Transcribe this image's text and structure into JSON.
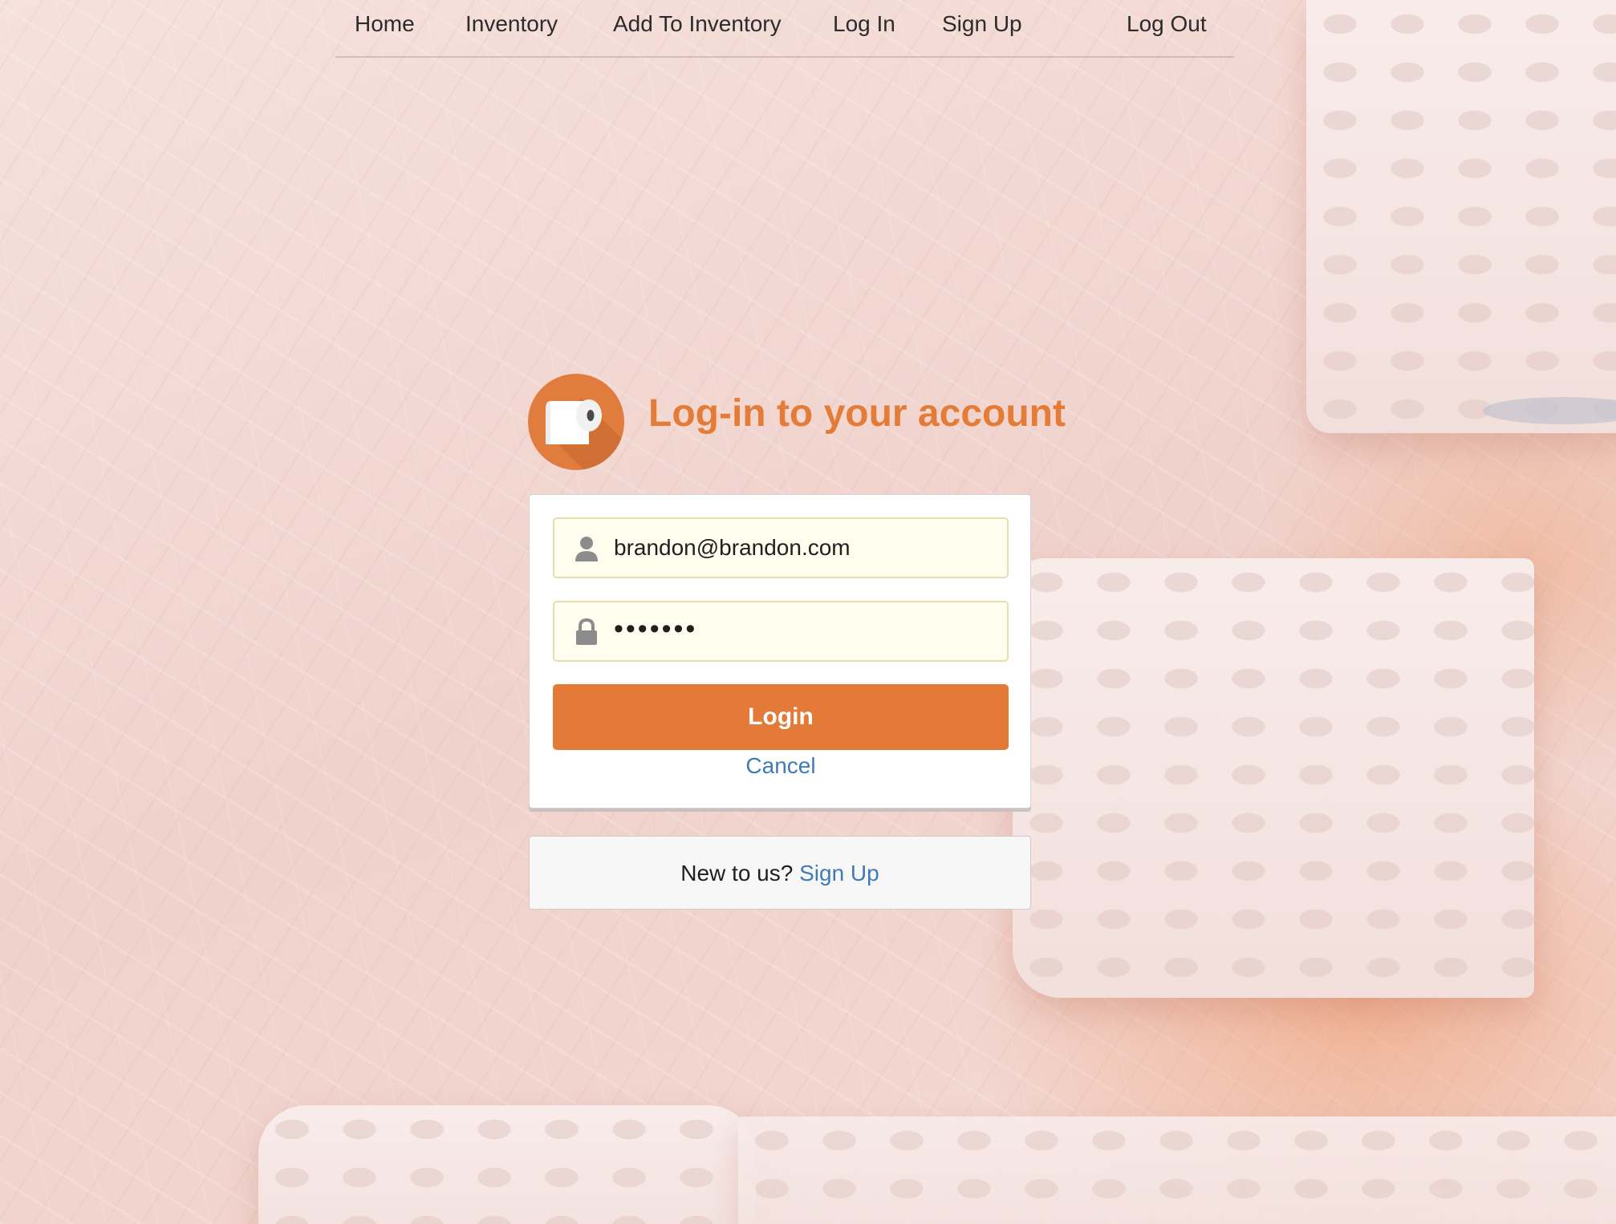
{
  "nav": {
    "items": [
      {
        "label": "Home"
      },
      {
        "label": "Inventory"
      },
      {
        "label": "Add To Inventory"
      },
      {
        "label": "Log In"
      },
      {
        "label": "Sign Up"
      },
      {
        "label": "Log Out"
      }
    ]
  },
  "header": {
    "logo_icon": "toilet-paper-roll-icon",
    "title": "Log-in to your account"
  },
  "form": {
    "email": {
      "icon": "user-icon",
      "value": "brandon@brandon.com"
    },
    "password": {
      "icon": "lock-icon",
      "value": "•••••••"
    },
    "login_label": "Login",
    "cancel_label": "Cancel"
  },
  "signup": {
    "prompt": "New to us?",
    "link_label": "Sign Up"
  },
  "colors": {
    "accent": "#e47a38",
    "link": "#3f7cb7",
    "field_bg": "#fefdee"
  }
}
